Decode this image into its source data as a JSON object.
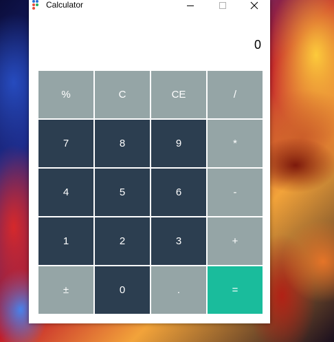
{
  "window": {
    "title": "Calculator",
    "icon": "calculator-dots-icon"
  },
  "display": {
    "value": "0"
  },
  "keys": [
    {
      "label": "%",
      "style": "gray",
      "name": "percent-button"
    },
    {
      "label": "C",
      "style": "gray",
      "name": "clear-button"
    },
    {
      "label": "CE",
      "style": "gray",
      "name": "clear-entry-button"
    },
    {
      "label": "/",
      "style": "gray",
      "name": "divide-button"
    },
    {
      "label": "7",
      "style": "dark",
      "name": "digit-7-button"
    },
    {
      "label": "8",
      "style": "dark",
      "name": "digit-8-button"
    },
    {
      "label": "9",
      "style": "dark",
      "name": "digit-9-button"
    },
    {
      "label": "*",
      "style": "gray",
      "name": "multiply-button"
    },
    {
      "label": "4",
      "style": "dark",
      "name": "digit-4-button"
    },
    {
      "label": "5",
      "style": "dark",
      "name": "digit-5-button"
    },
    {
      "label": "6",
      "style": "dark",
      "name": "digit-6-button"
    },
    {
      "label": "-",
      "style": "gray",
      "name": "subtract-button"
    },
    {
      "label": "1",
      "style": "dark",
      "name": "digit-1-button"
    },
    {
      "label": "2",
      "style": "dark",
      "name": "digit-2-button"
    },
    {
      "label": "3",
      "style": "dark",
      "name": "digit-3-button"
    },
    {
      "label": "+",
      "style": "gray",
      "name": "add-button"
    },
    {
      "label": "±",
      "style": "gray",
      "name": "negate-button"
    },
    {
      "label": "0",
      "style": "dark",
      "name": "digit-0-button"
    },
    {
      "label": ".",
      "style": "gray",
      "name": "decimal-button"
    },
    {
      "label": "=",
      "style": "teal",
      "name": "equals-button"
    }
  ],
  "colors": {
    "operator_key": "#95a5a6",
    "digit_key": "#2c3e50",
    "equals_key": "#1abc9c",
    "key_text": "#ffffff"
  }
}
